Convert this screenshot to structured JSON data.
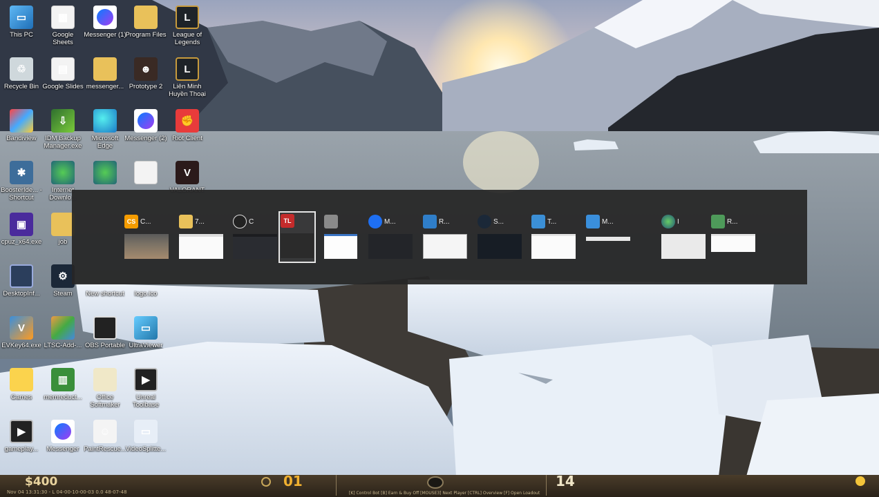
{
  "desktop": {
    "icons": [
      {
        "label": "This PC",
        "icon": "computer-icon"
      },
      {
        "label": "Google Sheets",
        "icon": "document-icon"
      },
      {
        "label": "Messenger (1)",
        "icon": "messenger-icon"
      },
      {
        "label": "Program Files",
        "icon": "folder-icon"
      },
      {
        "label": "League of Legends",
        "icon": "league-of-legends-icon"
      },
      {
        "label": "Recycle Bin",
        "icon": "recycle-bin-icon"
      },
      {
        "label": "Google Slides",
        "icon": "document-icon"
      },
      {
        "label": "messenger...",
        "icon": "folder-icon"
      },
      {
        "label": "Prototype 2",
        "icon": "game-icon"
      },
      {
        "label": "Liên Minh Huyền Thoại",
        "icon": "league-of-legends-icon"
      },
      {
        "label": "Bandiview",
        "icon": "bandiview-icon"
      },
      {
        "label": "IDM Backup Manager.exe",
        "icon": "idm-backup-icon"
      },
      {
        "label": "Microsoft Edge",
        "icon": "edge-icon"
      },
      {
        "label": "Messenger (2)",
        "icon": "messenger-icon"
      },
      {
        "label": "Riot Client",
        "icon": "riot-client-icon"
      },
      {
        "label": "BoosterIde... - Shortcut",
        "icon": "shortcut-icon"
      },
      {
        "label": "Internet Downlo...",
        "icon": "idm-icon"
      },
      {
        "label": "",
        "icon": "app-icon"
      },
      {
        "label": "",
        "icon": "document-icon"
      },
      {
        "label": "VALORANT",
        "icon": "valorant-icon"
      },
      {
        "label": "cpuz_x64.exe",
        "icon": "cpuz-icon"
      },
      {
        "label": "job",
        "icon": "folder-icon"
      },
      {
        "label": "DesktopInf...",
        "icon": "desktop-info-icon"
      },
      {
        "label": "Steam",
        "icon": "steam-icon"
      },
      {
        "label": "New shortcut",
        "icon": "shortcut-icon"
      },
      {
        "label": "logo.ico",
        "icon": "image-icon"
      },
      {
        "label": "EVKey64.exe",
        "icon": "evkey-icon"
      },
      {
        "label": "LTSC-Add-...",
        "icon": "ltsc-icon"
      },
      {
        "label": "OBS Portable",
        "icon": "obs-icon"
      },
      {
        "label": "UltraViewer",
        "icon": "ultraviewer-icon"
      },
      {
        "label": "Games",
        "icon": "games-folder-icon"
      },
      {
        "label": "memreduct...",
        "icon": "memreduct-icon"
      },
      {
        "label": "Office Softmaker",
        "icon": "folder-icon"
      },
      {
        "label": "Unreal Toolbase",
        "icon": "player-icon"
      },
      {
        "label": "gameplay...",
        "icon": "player-icon"
      },
      {
        "label": "Messenger",
        "icon": "messenger-icon"
      },
      {
        "label": "PaintRescue...",
        "icon": "paint-icon"
      },
      {
        "label": "VideoSplitte...",
        "icon": "video-icon"
      }
    ]
  },
  "switcher": {
    "items": [
      {
        "title": "C...",
        "icon": "counter-strike-icon",
        "active": false
      },
      {
        "title": "7...",
        "icon": "folder-icon",
        "active": false
      },
      {
        "title": "C",
        "icon": "obs-icon",
        "active": false
      },
      {
        "title": "",
        "icon": "tlauncher-icon",
        "active": true
      },
      {
        "title": "",
        "icon": "document-icon",
        "active": false
      },
      {
        "title": "M...",
        "icon": "messenger-icon",
        "active": false
      },
      {
        "title": "R...",
        "icon": "remote-desktop-icon",
        "active": false
      },
      {
        "title": "S...",
        "icon": "steam-icon",
        "active": false
      },
      {
        "title": "T...",
        "icon": "teamviewer-icon",
        "active": false
      },
      {
        "title": "M...",
        "icon": "monitor-icon",
        "active": false
      },
      {
        "title": "I",
        "icon": "idm-icon",
        "active": false
      },
      {
        "title": "R...",
        "icon": "registry-icon",
        "active": false
      }
    ]
  },
  "hud": {
    "money": "$400",
    "score_left": "01",
    "score_right": "14",
    "clock_text": "Nov 04 13:31:30 - L 04-00-10-00-03 0.0 48-07-48",
    "hints_text": "[K] Control Bot    [B] Earn & Buy Off    [MOUSE3] Next Player    [CTRL] Overview    [F] Open Loadout"
  },
  "colors": {
    "switcher_bg": "#262626",
    "active_border": "#e6e6e6",
    "hud_money": "#e8d39e",
    "hud_score": "#f0b030"
  }
}
